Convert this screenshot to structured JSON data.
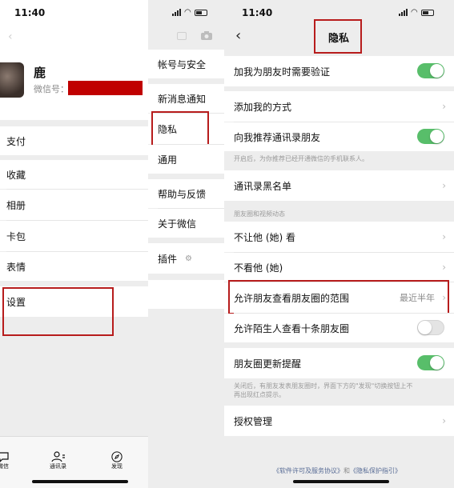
{
  "status_bar": {
    "time": "11:40"
  },
  "me_panel": {
    "name": "鹿",
    "wechat_id_label": "微信号：",
    "menu": [
      "支付",
      "收藏",
      "相册",
      "卡包",
      "表情",
      "设置"
    ],
    "tabs": [
      "微信",
      "通讯录",
      "发现"
    ]
  },
  "settings_panel": {
    "items": [
      "帐号与安全",
      "新消息通知",
      "隐私",
      "通用",
      "帮助与反馈",
      "关于微信",
      "插件"
    ]
  },
  "privacy_panel": {
    "title": "隐私",
    "verify_friend": "加我为朋友时需要验证",
    "add_methods": "添加我的方式",
    "recommend_contacts": "向我推荐通讯录朋友",
    "recommend_note": "开启后，为你推荐已经开通微信的手机联系人。",
    "blacklist": "通讯录黑名单",
    "section_moments": "朋友圈和视频动态",
    "hide_my_posts": "不让他 (她) 看",
    "hide_their_posts": "不看他 (她)",
    "moments_range": "允许朋友查看朋友圈的范围",
    "moments_range_value": "最近半年",
    "stranger_ten_posts": "允许陌生人查看十条朋友圈",
    "moments_update_reminder": "朋友圈更新提醒",
    "reminder_note_line1": "关闭后，有朋友发表朋友圈时，界面下方的\"发现\"切换按钮上不",
    "reminder_note_line2": "再出现红点提示。",
    "authorization": "授权管理",
    "footer_link1": "《软件许可及服务协议》",
    "footer_and": "和",
    "footer_link2": "《隐私保护指引》",
    "toggles": {
      "verify_friend": true,
      "recommend_contacts": true,
      "stranger_ten_posts": false,
      "moments_update_reminder": true
    }
  },
  "colors": {
    "highlight_border": "#b71c1c",
    "toggle_on": "#58be6a",
    "redaction": "#c00000"
  }
}
